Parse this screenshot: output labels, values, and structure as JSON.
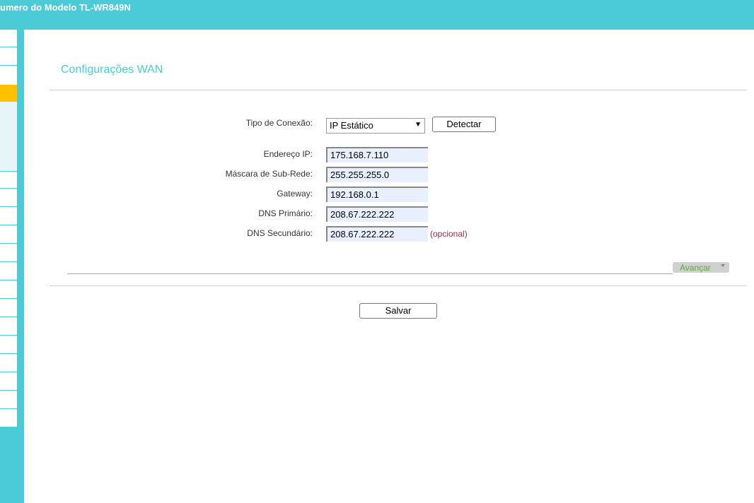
{
  "header": {
    "title": "umero do Modelo TL-WR849N"
  },
  "page": {
    "title": "Configurações WAN"
  },
  "form": {
    "connection_type_label": "Tipo de Conexão:",
    "connection_type_value": "IP Estático",
    "detect_label": "Detectar",
    "ip_label": "Endereço IP:",
    "ip_value": "175.168.7.110",
    "mask_label": "Máscara de Sub-Rede:",
    "mask_value": "255.255.255.0",
    "gateway_label": "Gateway:",
    "gateway_value": "192.168.0.1",
    "dns1_label": "DNS Primário:",
    "dns1_value": "208.67.222.222",
    "dns2_label": "DNS Secundário:",
    "dns2_value": "208.67.222.222",
    "optional_label": "(opcional)",
    "advanced_label": "Avançar",
    "save_label": "Salvar"
  },
  "colors": {
    "accent": "#4acbd6",
    "active_menu": "#ffc000",
    "optional_text": "#9b2c4a",
    "advanced_text": "#5aab3a"
  }
}
